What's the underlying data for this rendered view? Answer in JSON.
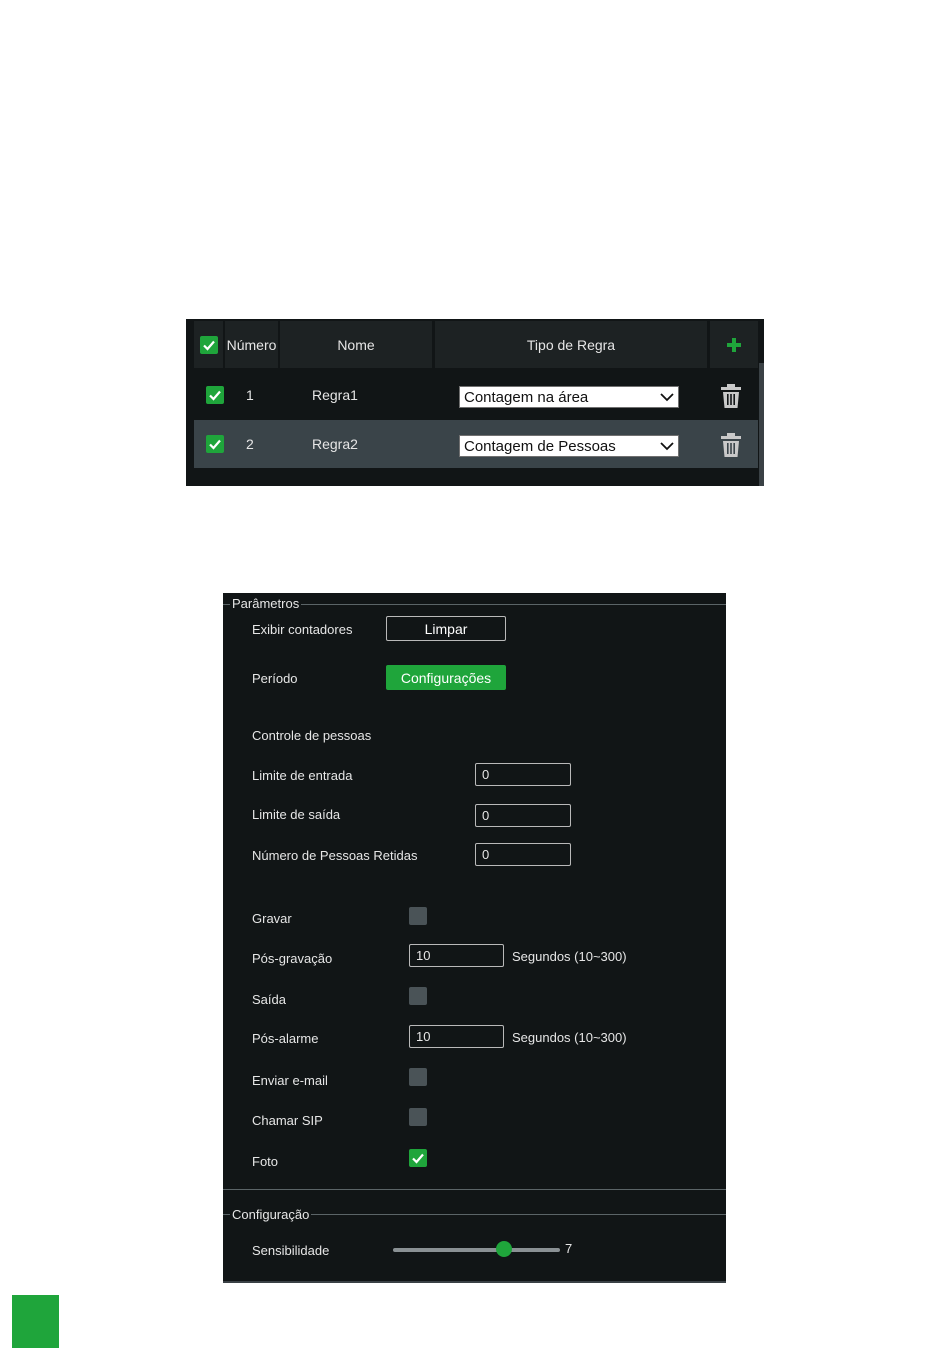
{
  "rules_table": {
    "headers": {
      "number": "Número",
      "name": "Nome",
      "rule_type": "Tipo de Regra"
    },
    "header_select_all_checked": true,
    "rows": [
      {
        "checked": true,
        "number": "1",
        "name": "Regra1",
        "rule_type": "Contagem na área",
        "selected": false
      },
      {
        "checked": true,
        "number": "2",
        "name": "Regra2",
        "rule_type": "Contagem de Pessoas",
        "selected": true
      }
    ]
  },
  "parameters": {
    "legend": "Parâmetros",
    "show_counters": {
      "label": "Exibir contadores",
      "button": "Limpar"
    },
    "period": {
      "label": "Período",
      "button": "Configurações"
    },
    "people_control_label": "Controle de pessoas",
    "entry_limit": {
      "label": "Limite de entrada",
      "value": "0"
    },
    "exit_limit": {
      "label": "Limite de saída",
      "value": "0"
    },
    "retained_people": {
      "label": "Número de Pessoas Retidas",
      "value": "0"
    },
    "record": {
      "label": "Gravar",
      "checked": false
    },
    "post_record": {
      "label": "Pós-gravação",
      "value": "10",
      "unit": "Segundos (10~300)"
    },
    "output": {
      "label": "Saída",
      "checked": false
    },
    "post_alarm": {
      "label": "Pós-alarme",
      "value": "10",
      "unit": "Segundos (10~300)"
    },
    "send_email": {
      "label": "Enviar e-mail",
      "checked": false
    },
    "call_sip": {
      "label": "Chamar SIP",
      "checked": false
    },
    "photo": {
      "label": "Foto",
      "checked": true
    }
  },
  "configuration": {
    "legend": "Configuração",
    "sensitivity": {
      "label": "Sensibilidade",
      "value": 7,
      "value_text": "7",
      "min": 1,
      "max": 10
    }
  },
  "colors": {
    "accent": "#1fa53b",
    "panel_bg": "#111516",
    "header_bg": "#1d2223",
    "selected_row": "#3a4449"
  }
}
